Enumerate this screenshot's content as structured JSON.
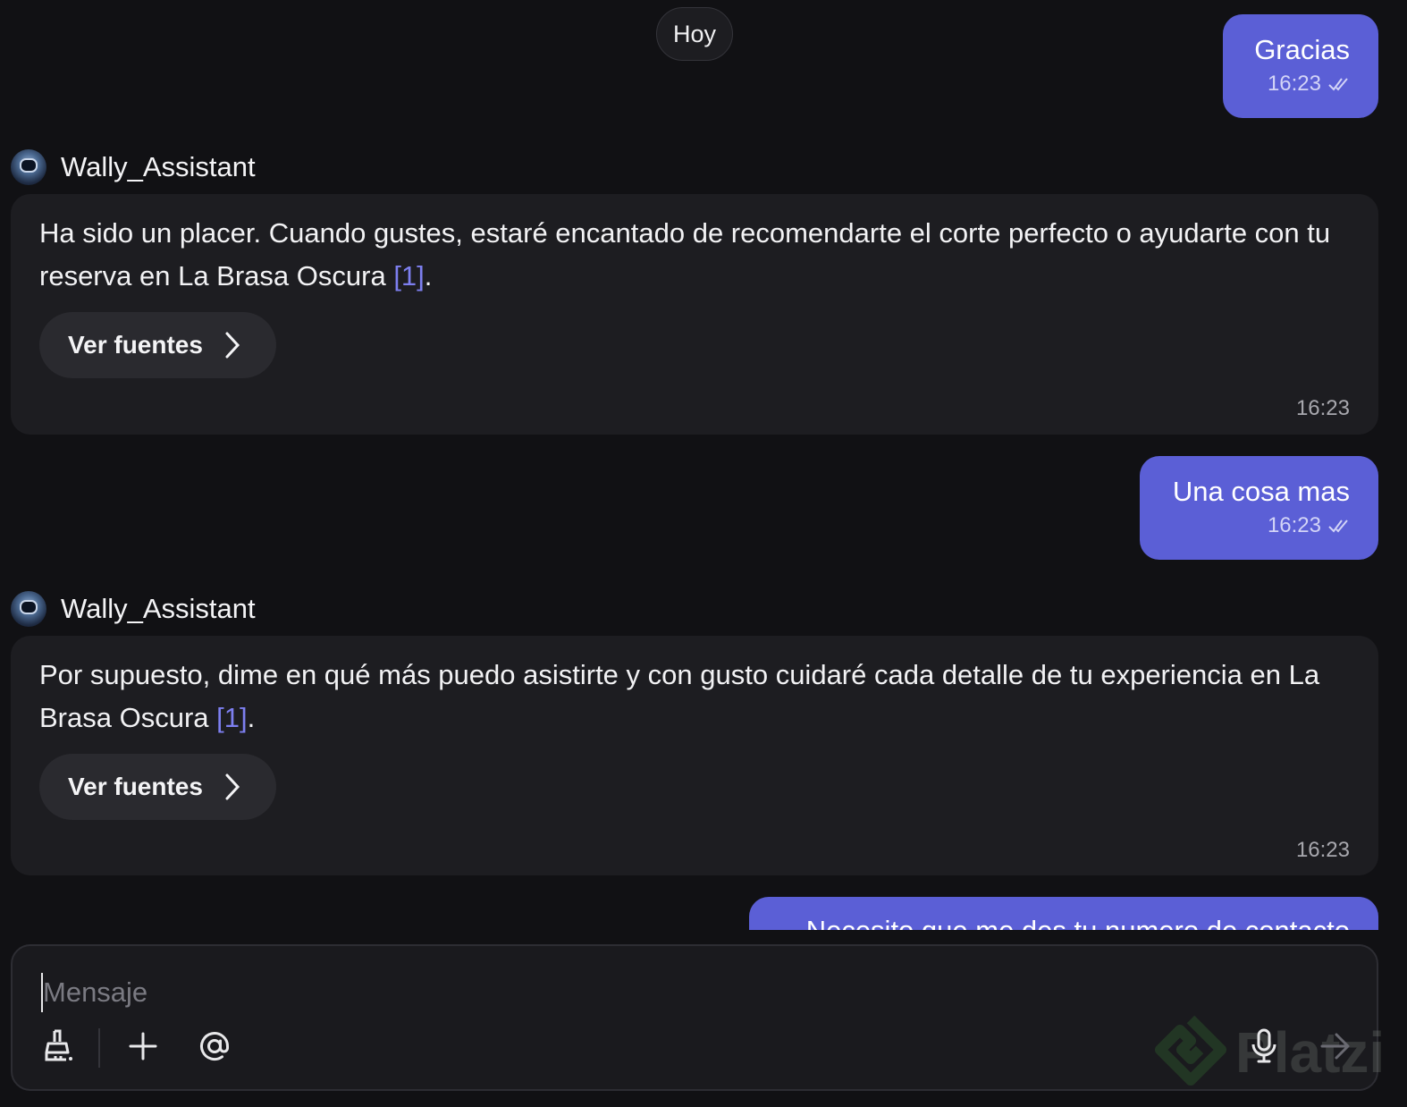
{
  "day_separator": "Hoy",
  "messages": [
    {
      "kind": "out",
      "text": "Gracias",
      "time": "16:23"
    },
    {
      "kind": "in",
      "sender": "Wally_Assistant",
      "text": "Ha sido un placer. Cuando gustes, estaré encantado de recomendarte el corte perfecto o ayudarte con tu reserva en La Brasa Oscura",
      "citation": "[1]",
      "end": ".",
      "sources_label": "Ver fuentes",
      "time": "16:23"
    },
    {
      "kind": "out",
      "text": "Una cosa mas",
      "time": "16:23"
    },
    {
      "kind": "in",
      "sender": "Wally_Assistant",
      "text": "Por supuesto, dime en qué más puedo asistirte y con gusto cuidaré cada detalle de tu experiencia en La Brasa Oscura",
      "citation": "[1]",
      "end": ".",
      "sources_label": "Ver fuentes",
      "time": "16:23"
    },
    {
      "kind": "out",
      "text": "Necesito que me des tu numero de contacto",
      "partially_visible": true
    }
  ],
  "composer": {
    "placeholder": "Mensaje",
    "tools": [
      "broom-icon",
      "plus-icon",
      "at-icon",
      "microphone-icon",
      "send-arrow-icon"
    ]
  },
  "watermark": "Platzi",
  "colors": {
    "background": "#111114",
    "bubble_out": "#5b5fd6",
    "bubble_in": "#1d1d21",
    "citation": "#7d7ff0"
  }
}
